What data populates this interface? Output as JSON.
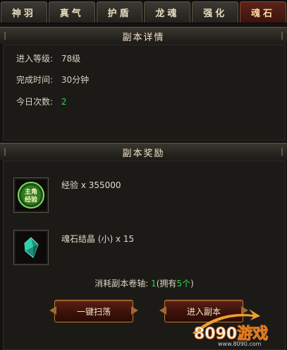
{
  "tabs": [
    {
      "label": "神羽"
    },
    {
      "label": "真气"
    },
    {
      "label": "护盾"
    },
    {
      "label": "龙魂"
    },
    {
      "label": "强化"
    },
    {
      "label": "魂石"
    }
  ],
  "active_tab_index": 5,
  "details": {
    "title": "副本详情",
    "level_label": "进入等级:",
    "level_value": "78级",
    "time_label": "完成时间:",
    "time_value": "30分钟",
    "count_label": "今日次数:",
    "count_value": "2"
  },
  "rewards": {
    "title": "副本奖励",
    "items": [
      {
        "icon": "exp-badge-icon",
        "icon_text_1": "主角",
        "icon_text_2": "经验",
        "text": "经验 x 355000"
      },
      {
        "icon": "crystal-icon",
        "text": "魂石结晶 (小) x 15"
      }
    ]
  },
  "cost": {
    "prefix": "消耗副本卷轴:",
    "count": "1",
    "own_prefix": "(拥有",
    "own_count": "5个",
    "own_suffix": ")"
  },
  "buttons": {
    "sweep": "一键扫荡",
    "enter": "进入副本"
  },
  "watermark": {
    "main": "8090游戏",
    "sub": "www.8090.com"
  },
  "colors": {
    "accent_green": "#39d24a",
    "active_tab": "#5c2218",
    "button_border": "#b07a3a"
  }
}
